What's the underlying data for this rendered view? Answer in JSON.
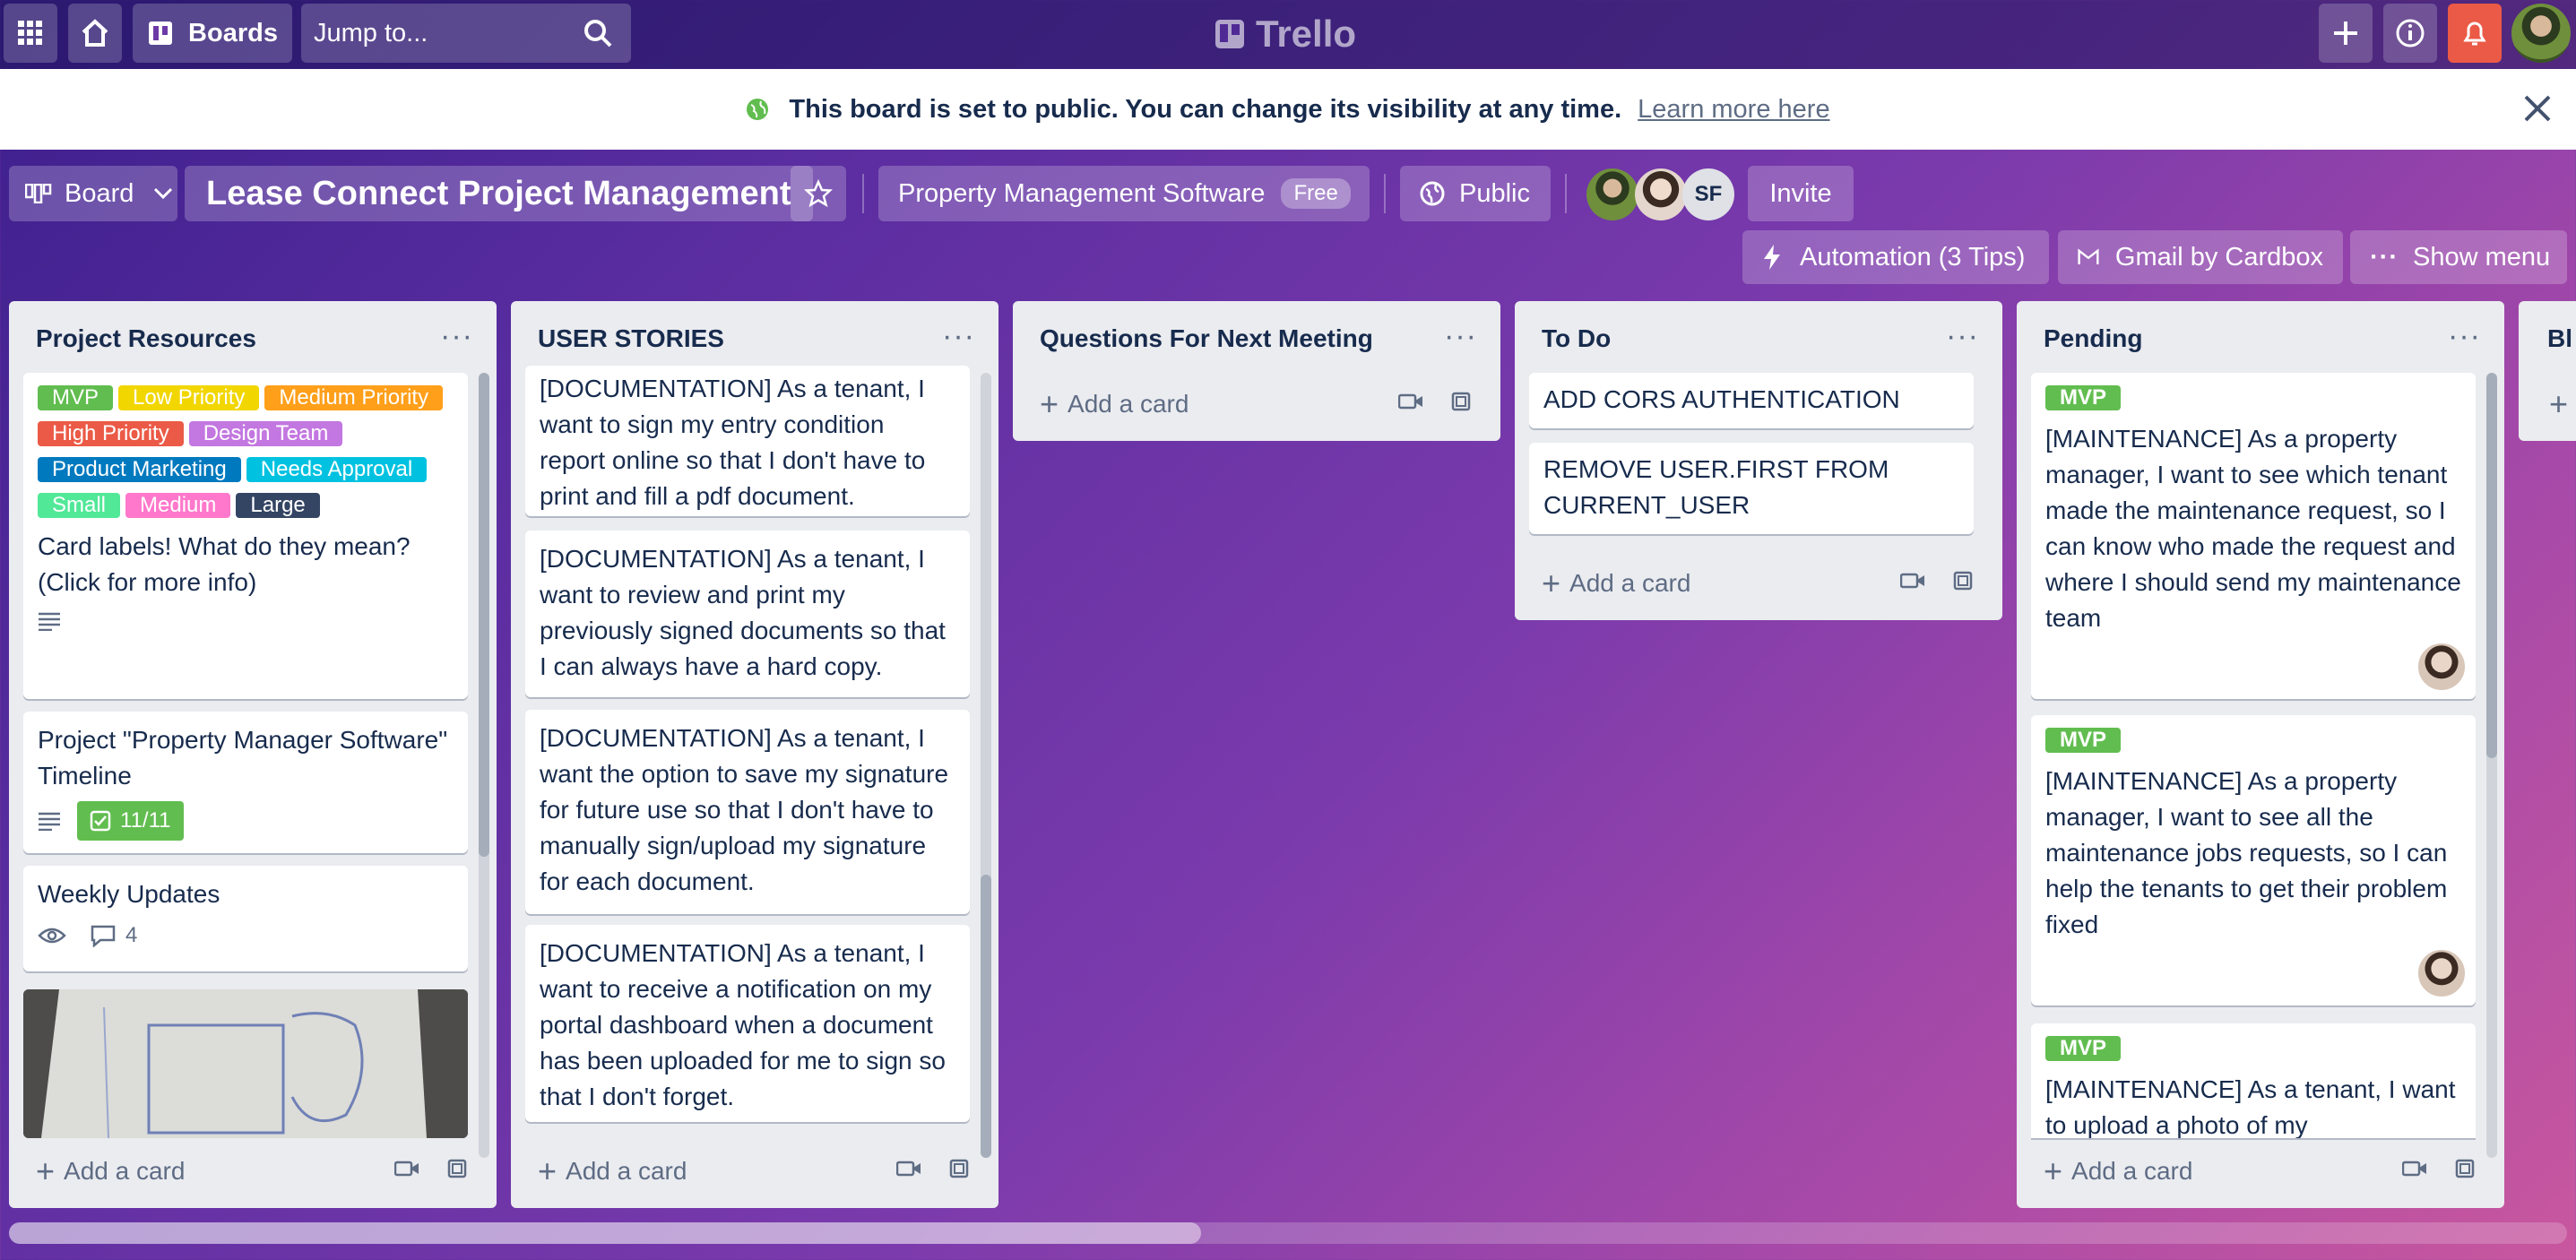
{
  "topbar": {
    "boards_label": "Boards",
    "jump_placeholder": "Jump to...",
    "logo_text": "Trello"
  },
  "banner": {
    "message": "This board is set to public. You can change its visibility at any time.",
    "link": "Learn more here"
  },
  "board": {
    "view_label": "Board",
    "title": "Lease Connect Project Management",
    "workspace": "Property Management Software",
    "workspace_badge": "Free",
    "visibility": "Public",
    "member_initials": "SF",
    "invite_label": "Invite",
    "automation_label": "Automation (3 Tips)",
    "gmail_label": "Gmail by Cardbox",
    "show_menu_label": "Show menu"
  },
  "add_card_label": "Add a card",
  "lists": [
    {
      "title": "Project Resources",
      "labels": [
        {
          "text": "MVP",
          "color": "#61bd4f"
        },
        {
          "text": "Low Priority",
          "color": "#f2d600"
        },
        {
          "text": "Medium Priority",
          "color": "#ff9f1a"
        },
        {
          "text": "High Priority",
          "color": "#eb5a46"
        },
        {
          "text": "Design Team",
          "color": "#c377e0"
        },
        {
          "text": "Product Marketing",
          "color": "#0079bf"
        },
        {
          "text": "Needs Approval",
          "color": "#00c2e0"
        },
        {
          "text": "Small",
          "color": "#51e898"
        },
        {
          "text": "Medium",
          "color": "#ff78cb"
        },
        {
          "text": "Large",
          "color": "#344563"
        }
      ],
      "cards": [
        {
          "text": "Card labels! What do they mean? (Click for more info)"
        },
        {
          "text": "Project \"Property Manager Software\" Timeline",
          "checklist": "11/11"
        },
        {
          "text": "Weekly Updates",
          "comments": "4"
        }
      ]
    },
    {
      "title": "USER STORIES",
      "cards": [
        {
          "text": "[DOCUMENTATION] As a tenant, I want to sign my entry condition report online so that I don't have to print and fill a pdf document."
        },
        {
          "text": "[DOCUMENTATION] As a tenant, I want to review and print my previously signed documents so that I can always have a hard copy."
        },
        {
          "text": "[DOCUMENTATION] As a tenant, I want the option to save my signature for future use so that I don't have to manually sign/upload my signature for each document."
        },
        {
          "text": "[DOCUMENTATION] As a tenant, I want to receive a notification on my portal dashboard when a document has been uploaded for me to sign so that I don't forget."
        }
      ]
    },
    {
      "title": "Questions For Next Meeting",
      "cards": []
    },
    {
      "title": "To Do",
      "cards": [
        {
          "text": "ADD CORS AUTHENTICATION"
        },
        {
          "text": "REMOVE USER.FIRST FROM CURRENT_USER"
        }
      ]
    },
    {
      "title": "Pending",
      "cards": [
        {
          "label": "MVP",
          "text": "[MAINTENANCE] As a property manager, I want to see which tenant made the maintenance request, so I can know who made the request and where I should send my maintenance team"
        },
        {
          "label": "MVP",
          "text": "[MAINTENANCE] As a property manager, I want to see all the maintenance jobs requests, so I can help the tenants to get their problem fixed"
        },
        {
          "label": "MVP",
          "text": "[MAINTENANCE] As a tenant, I want to upload a photo of my"
        }
      ]
    },
    {
      "title": "Bl"
    }
  ]
}
